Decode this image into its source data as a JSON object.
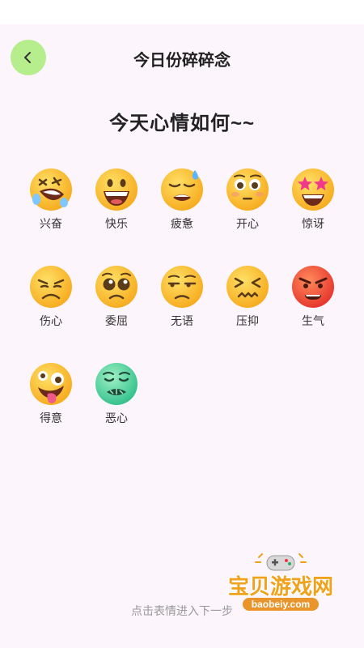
{
  "header": {
    "title": "今日份碎碎念"
  },
  "question": "今天心情如何~~",
  "emotions": [
    {
      "label": "兴奋",
      "icon": "rofl-emoji-icon"
    },
    {
      "label": "快乐",
      "icon": "grinning-emoji-icon"
    },
    {
      "label": "疲惫",
      "icon": "tired-sweat-emoji-icon"
    },
    {
      "label": "开心",
      "icon": "flushed-emoji-icon"
    },
    {
      "label": "惊讶",
      "icon": "star-struck-emoji-icon"
    },
    {
      "label": "伤心",
      "icon": "sad-emoji-icon"
    },
    {
      "label": "委屈",
      "icon": "pleading-emoji-icon"
    },
    {
      "label": "无语",
      "icon": "unamused-emoji-icon"
    },
    {
      "label": "压抑",
      "icon": "confounded-emoji-icon"
    },
    {
      "label": "生气",
      "icon": "angry-emoji-icon"
    },
    {
      "label": "得意",
      "icon": "zany-emoji-icon"
    },
    {
      "label": "恶心",
      "icon": "nauseated-emoji-icon"
    }
  ],
  "hint": "点击表情进入下一步",
  "watermark": {
    "text": "宝贝游戏网",
    "url": "baobeiy.com"
  },
  "colors": {
    "background": "#fcf5fb",
    "back_button": "#b6ee8e",
    "emoji_yellow": "#fcc636",
    "emoji_red": "#f25a3a",
    "emoji_green": "#5fd8a6"
  }
}
